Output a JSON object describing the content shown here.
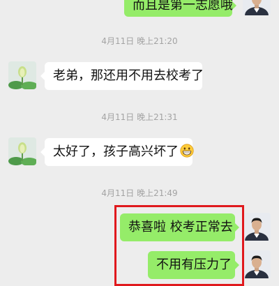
{
  "messages": [
    {
      "direction": "outgoing",
      "text": "而且是第一志愿哦",
      "avatar": "user-avatar-man"
    },
    {
      "direction": "incoming",
      "text": "老弟，那还用不用去校考了",
      "avatar": "contact-avatar-lotus"
    },
    {
      "direction": "incoming",
      "text": "太好了，孩子高兴坏了",
      "emoji": "grinning-face-icon",
      "avatar": "contact-avatar-lotus"
    },
    {
      "direction": "outgoing",
      "text": "恭喜啦 校考正常去",
      "avatar": "user-avatar-man"
    },
    {
      "direction": "outgoing",
      "text": "不用有压力了",
      "avatar": "user-avatar-man"
    }
  ],
  "timestamps": [
    "4月11日 晚上21:20",
    "4月11日 晚上21:31",
    "4月11日 晚上21:49"
  ],
  "colors": {
    "background": "#ededed",
    "incoming_bubble": "#ffffff",
    "outgoing_bubble": "#95ec69",
    "highlight_border": "#e0191d"
  }
}
